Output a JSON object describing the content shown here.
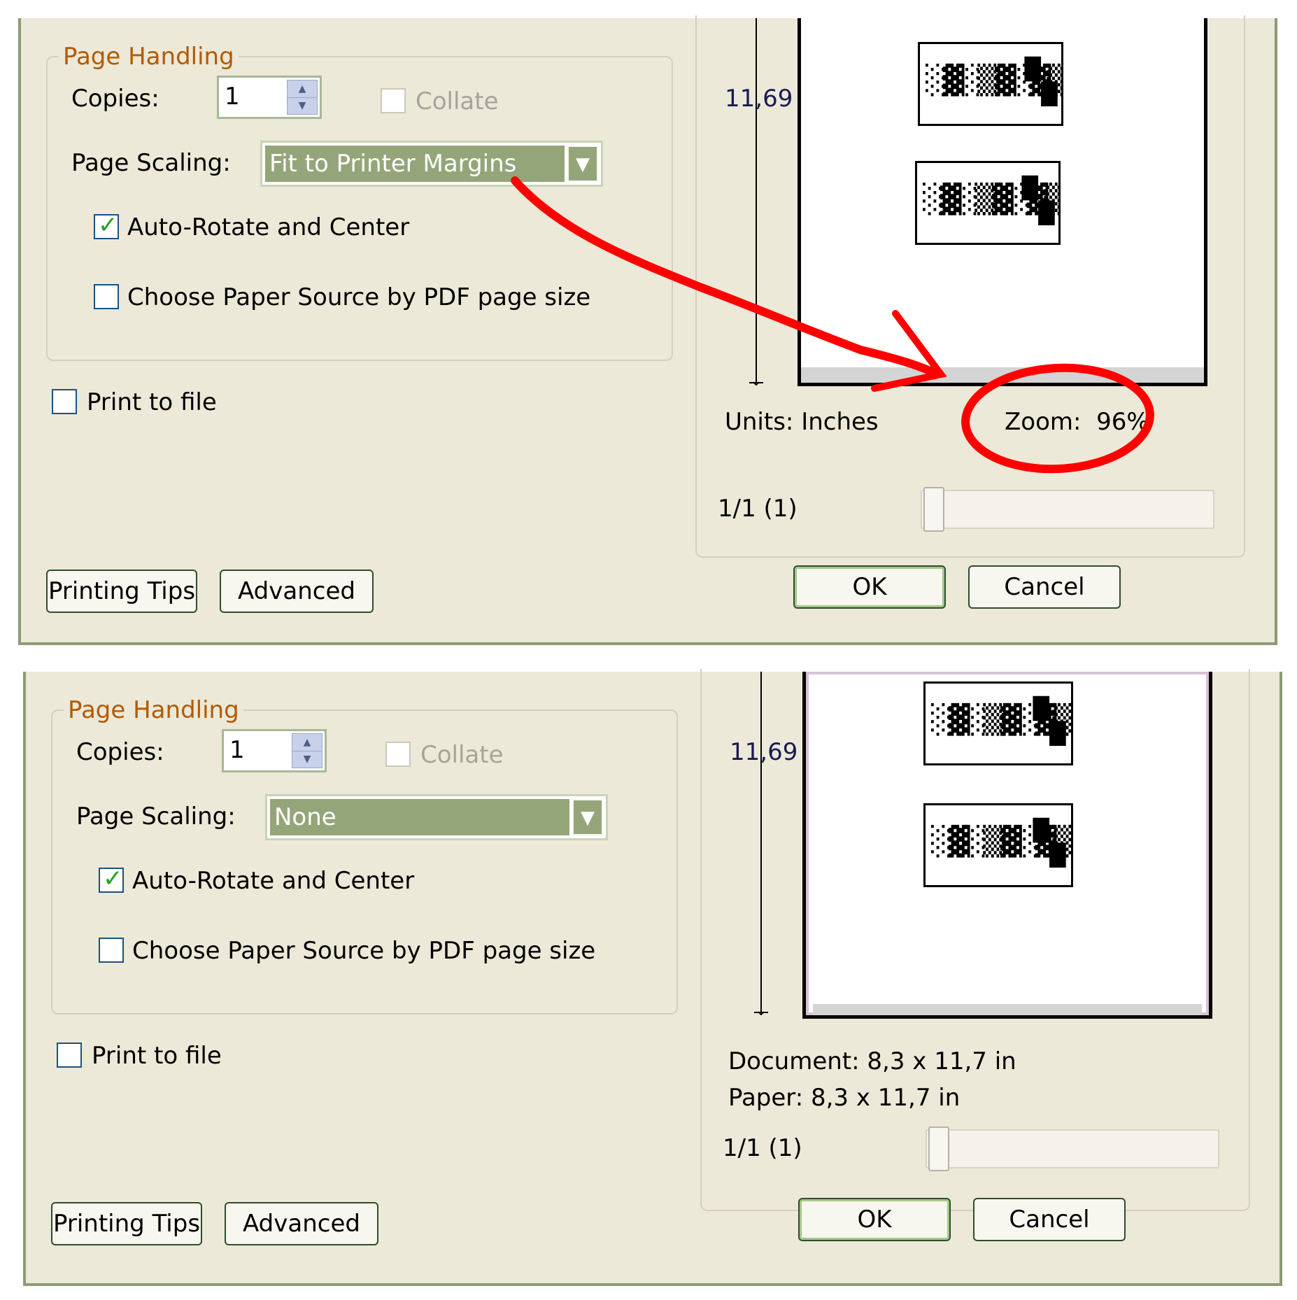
{
  "panels": [
    {
      "page_handling": {
        "title": "Page Handling",
        "copies_label": "Copies:",
        "copies_value": "1",
        "collate_label": "Collate",
        "page_scaling_label": "Page Scaling:",
        "page_scaling_value": "Fit to Printer Margins",
        "auto_rotate_label": "Auto-Rotate and Center",
        "auto_rotate_checked": true,
        "paper_source_label": "Choose Paper Source by PDF page size",
        "paper_source_checked": false
      },
      "print_to_file_label": "Print to file",
      "preview": {
        "ruler_value": "11,69",
        "info_left": "Units: Inches",
        "info_right": "Zoom:  96%",
        "page_counter": "1/1 (1)"
      },
      "buttons": {
        "printing_tips": "Printing Tips",
        "advanced": "Advanced",
        "ok": "OK",
        "cancel": "Cancel"
      }
    },
    {
      "page_handling": {
        "title": "Page Handling",
        "copies_label": "Copies:",
        "copies_value": "1",
        "collate_label": "Collate",
        "page_scaling_label": "Page Scaling:",
        "page_scaling_value": "None",
        "auto_rotate_label": "Auto-Rotate and Center",
        "auto_rotate_checked": true,
        "paper_source_label": "Choose Paper Source by PDF page size",
        "paper_source_checked": false
      },
      "print_to_file_label": "Print to file",
      "preview": {
        "ruler_value": "11,69",
        "document_label": "Document: 8,3 x 11,7 in",
        "paper_label": "Paper: 8,3 x 11,7 in",
        "page_counter": "1/1 (1)"
      },
      "buttons": {
        "printing_tips": "Printing Tips",
        "advanced": "Advanced",
        "ok": "OK",
        "cancel": "Cancel"
      }
    }
  ],
  "colors": {
    "dialog_bg": "#ece9d8",
    "group_title": "#b35a00",
    "dropdown_selected": "#95a57a",
    "annotation": "#ff0000"
  },
  "icons": {
    "checkmark": "check-icon",
    "dropdown": "chevron-down-icon",
    "spin": "spin-arrows-icon"
  }
}
